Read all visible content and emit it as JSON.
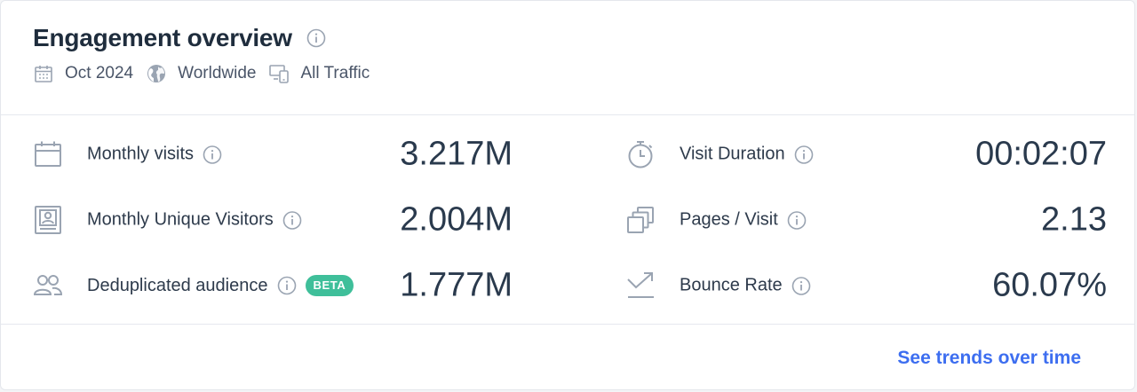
{
  "header": {
    "title": "Engagement overview",
    "filters": [
      {
        "icon": "calendar-icon",
        "label": "Oct 2024"
      },
      {
        "icon": "globe-icon",
        "label": "Worldwide"
      },
      {
        "icon": "devices-icon",
        "label": "All Traffic"
      }
    ]
  },
  "metrics_left": [
    {
      "icon": "calendar-page-icon",
      "label": "Monthly visits",
      "value": "3.217M"
    },
    {
      "icon": "id-card-icon",
      "label": "Monthly Unique Visitors",
      "value": "2.004M"
    },
    {
      "icon": "people-icon",
      "label": "Deduplicated audience",
      "badge": "BETA",
      "value": "1.777M"
    }
  ],
  "metrics_right": [
    {
      "icon": "stopwatch-icon",
      "label": "Visit Duration",
      "value": "00:02:07"
    },
    {
      "icon": "stacked-pages-icon",
      "label": "Pages / Visit",
      "value": "2.13"
    },
    {
      "icon": "bounce-arrow-icon",
      "label": "Bounce Rate",
      "value": "60.07%"
    }
  ],
  "footer": {
    "link_label": "See trends over time"
  },
  "colors": {
    "accent": "#3d6ef0",
    "beta_badge": "#3fbf9a",
    "icon_gray": "#9aa4b2"
  }
}
